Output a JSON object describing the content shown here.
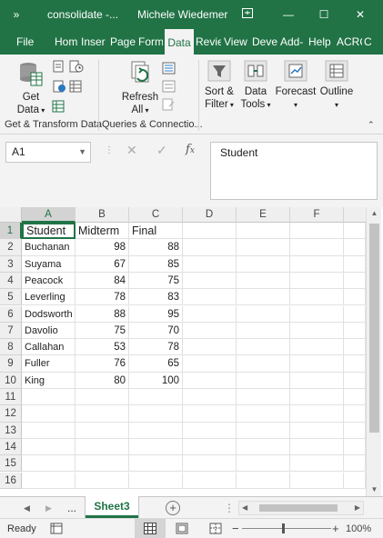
{
  "titlebar": {
    "autosave_glyph": "»",
    "title": "consolidate  -...",
    "user": "Michele Wiedemer"
  },
  "tabs": [
    {
      "label": "File"
    },
    {
      "label": "Hom"
    },
    {
      "label": "Inser"
    },
    {
      "label": "Page"
    },
    {
      "label": "Form"
    },
    {
      "label": "Data",
      "active": true
    },
    {
      "label": "Revie"
    },
    {
      "label": "View"
    },
    {
      "label": "Deve"
    },
    {
      "label": "Add-"
    },
    {
      "label": "Help"
    },
    {
      "label": "ACRO"
    },
    {
      "label": "C"
    }
  ],
  "ribbon": {
    "get_data_1": "Get",
    "get_data_2": "Data",
    "refresh_1": "Refresh",
    "refresh_2": "All",
    "sort_filter_1": "Sort &",
    "sort_filter_2": "Filter",
    "data_tools_1": "Data",
    "data_tools_2": "Tools",
    "forecast": "Forecast",
    "outline": "Outline",
    "group1_label": "Get & Transform Data",
    "group2_label": "Queries & Connectio..."
  },
  "formula_bar": {
    "name_box": "A1",
    "formula": "Student"
  },
  "columns": [
    "A",
    "B",
    "C",
    "D",
    "E",
    "F"
  ],
  "rows": [
    "1",
    "2",
    "3",
    "4",
    "5",
    "6",
    "7",
    "8",
    "9",
    "10",
    "11",
    "12",
    "13",
    "14",
    "15",
    "16"
  ],
  "sheet": {
    "header": [
      "Student",
      "Midterm",
      "Final"
    ],
    "data": [
      [
        "Buchanan",
        "98",
        "88"
      ],
      [
        "Suyama",
        "67",
        "85"
      ],
      [
        "Peacock",
        "84",
        "75"
      ],
      [
        "Leverling",
        "78",
        "83"
      ],
      [
        "Dodsworth",
        "88",
        "95"
      ],
      [
        "Davolio",
        "75",
        "70"
      ],
      [
        "Callahan",
        "53",
        "78"
      ],
      [
        "Fuller",
        "76",
        "65"
      ],
      [
        "King",
        "80",
        "100"
      ]
    ]
  },
  "sheet_tabs": {
    "ellipsis": "...",
    "active": "Sheet3"
  },
  "status": {
    "ready": "Ready",
    "zoom": "100%"
  },
  "accent_color": "#217346"
}
